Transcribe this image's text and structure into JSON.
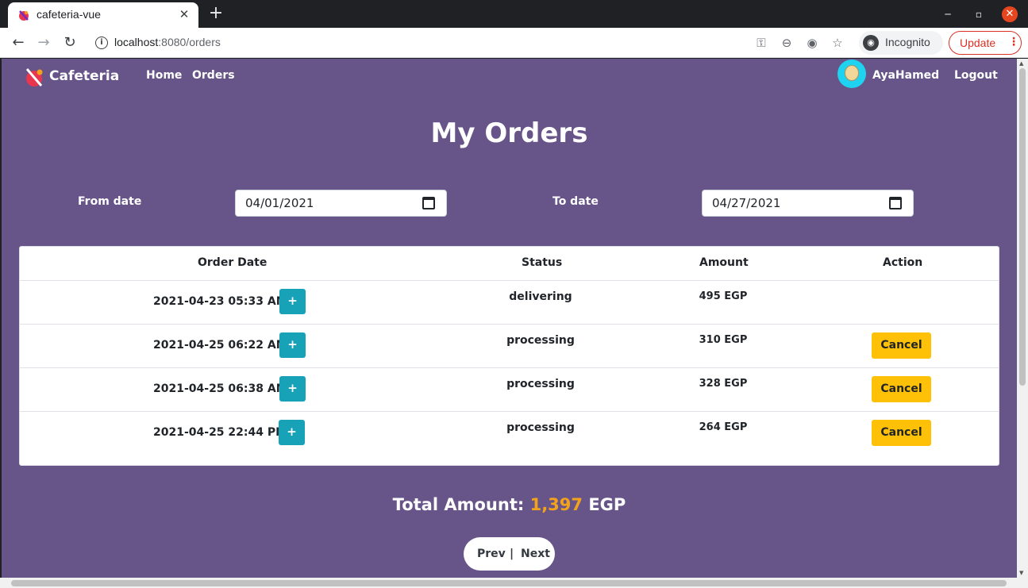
{
  "browser": {
    "tab_title": "cafeteria-vue",
    "new_tab": "+",
    "url_host": "localhost",
    "url_path": ":8080/orders",
    "incognito_label": "Incognito",
    "update_label": "Update",
    "icons": [
      "back-arrow-icon",
      "forward-arrow-icon",
      "reload-icon",
      "info-icon",
      "key-icon",
      "zoom-icon",
      "eye-off-icon",
      "star-icon",
      "incognito-icon",
      "kebab-icon"
    ]
  },
  "navbar": {
    "brand": "Cafeteria",
    "links": [
      "Home",
      "Orders"
    ],
    "username": "AyaHamed",
    "logout": "Logout"
  },
  "page": {
    "title": "My Orders",
    "from_label": "From date",
    "from_value": "04/01/2021",
    "to_label": "To date",
    "to_value": "04/27/2021"
  },
  "table": {
    "headers": [
      "Order Date",
      "Status",
      "Amount",
      "Action"
    ],
    "rows": [
      {
        "date": "2021-04-23 05:33 AM",
        "status": "delivering",
        "amount": "495 EGP",
        "action": ""
      },
      {
        "date": "2021-04-25 06:22 AM",
        "status": "processing",
        "amount": "310 EGP",
        "action": "Cancel"
      },
      {
        "date": "2021-04-25 06:38 AM",
        "status": "processing",
        "amount": "328 EGP",
        "action": "Cancel"
      },
      {
        "date": "2021-04-25 22:44 PM",
        "status": "processing",
        "amount": "264 EGP",
        "action": "Cancel"
      }
    ],
    "expand_label": "+"
  },
  "total": {
    "label": "Total Amount:",
    "value": "1,397",
    "currency": "EGP"
  },
  "pager": {
    "prev": "Prev",
    "separator": "|",
    "next": "Next"
  },
  "colors": {
    "page_bg": "#675489",
    "info_btn": "#17a2b8",
    "cancel_btn": "#ffc107",
    "total_accent": "#f2a31b"
  }
}
